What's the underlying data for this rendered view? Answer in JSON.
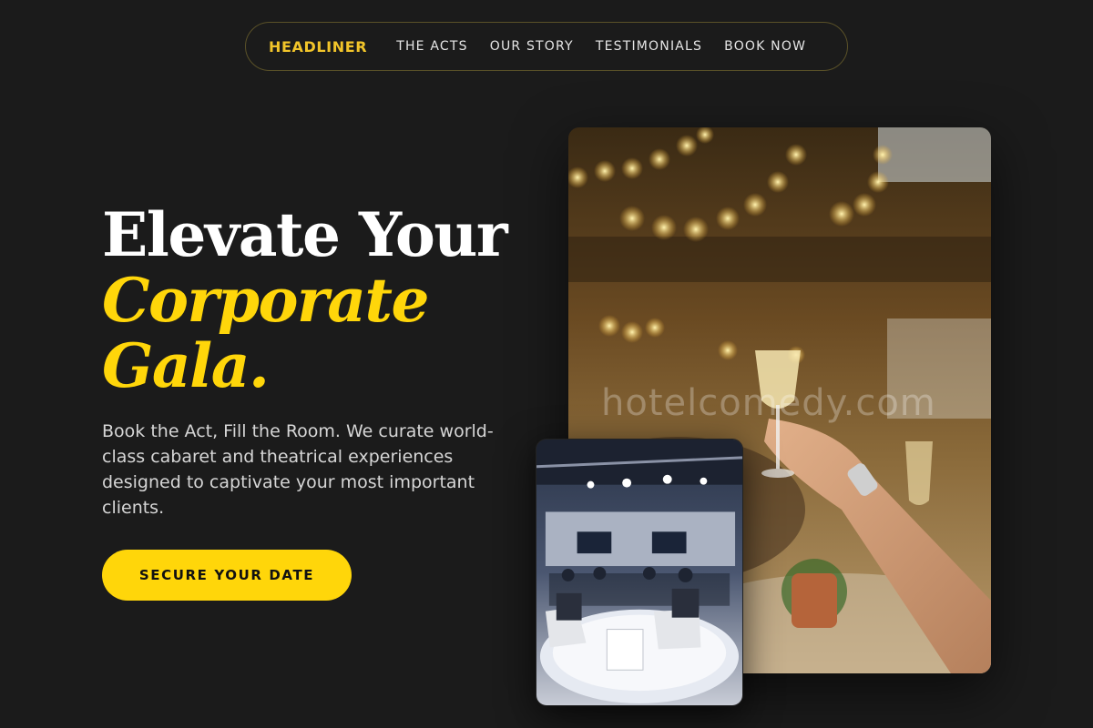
{
  "nav": {
    "brand": "HEADLINER",
    "links": [
      "THE ACTS",
      "OUR STORY",
      "TESTIMONIALS",
      "BOOK NOW"
    ]
  },
  "hero": {
    "title_line1": "Elevate Your",
    "title_accent1": "Corporate",
    "title_accent2": "Gala.",
    "description": "Book the Act, Fill the Room. We curate world-class cabaret and theatrical experiences designed to captivate your most important clients.",
    "cta_label": "SECURE YOUR DATE"
  },
  "images": {
    "large": "gala-toast-photo",
    "small": "panel-stage-photo",
    "watermark": "hotelcomedy.com"
  },
  "colors": {
    "background": "#1b1b1b",
    "accent": "#ffd60a",
    "brand": "#f2c52a",
    "text_muted": "#d6d6d6"
  }
}
